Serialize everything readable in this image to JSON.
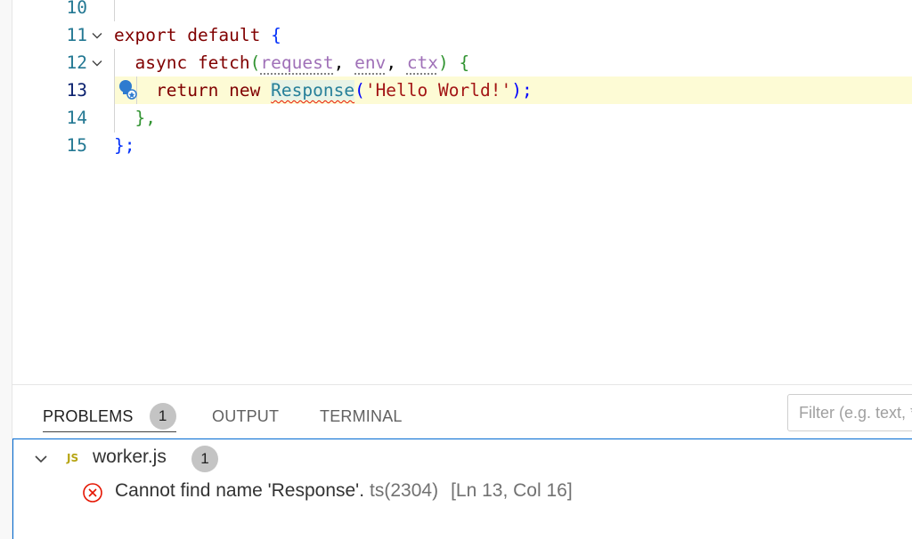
{
  "editor": {
    "lines": [
      {
        "number": "10"
      },
      {
        "number": "11"
      },
      {
        "number": "12"
      },
      {
        "number": "13"
      },
      {
        "number": "14"
      },
      {
        "number": "15"
      }
    ],
    "code": {
      "l11_export": "export",
      "l11_default": "default",
      "l11_brace": "{",
      "l12_async": "async",
      "l12_fetch": "fetch",
      "l12_open": "(",
      "l12_request": "request",
      "l12_comma1": ",",
      "l12_env": "env",
      "l12_comma2": ",",
      "l12_ctx": "ctx",
      "l12_close": ")",
      "l12_brace": "{",
      "l13_return": "return",
      "l13_new": "new",
      "l13_response": "Response",
      "l13_open": "(",
      "l13_string": "'Hello World!'",
      "l13_close": ");",
      "l14_close": "},",
      "l15_close": "};"
    }
  },
  "panel": {
    "tabs": [
      {
        "label": "PROBLEMS",
        "badge": "1"
      },
      {
        "label": "OUTPUT"
      },
      {
        "label": "TERMINAL"
      }
    ],
    "filter_placeholder": "Filter (e.g. text, **/*.ts, !**/node_modules/**)",
    "file": {
      "type_label": "JS",
      "name": "worker.js",
      "count": "1"
    },
    "problem": {
      "message": "Cannot find name 'Response'.",
      "source": "ts(2304)",
      "location": "[Ln 13, Col 16]"
    }
  },
  "colors": {
    "accent": "#0069d1",
    "error": "#e51400",
    "current_line": "#fdfbd5"
  }
}
